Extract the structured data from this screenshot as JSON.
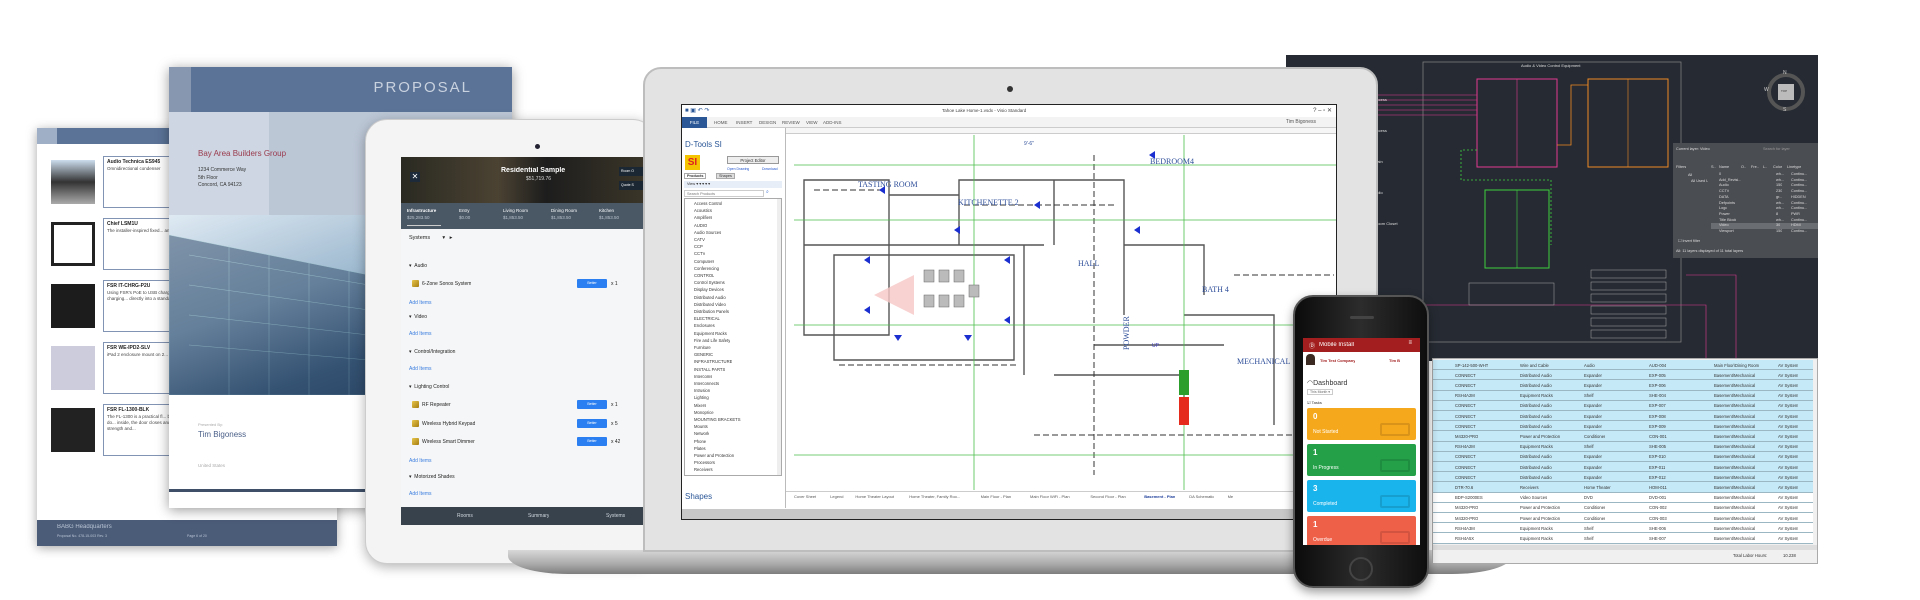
{
  "product_sheet": {
    "items": [
      {
        "title": "Audio Technica ES945",
        "desc": "Omnidirectional condenser"
      },
      {
        "title": "Chief LSM1U",
        "desc": "The installer-inspired fixed... and post-installation fine tu..."
      },
      {
        "title": "FSR IT-CHRG-P2U",
        "desc": "Using FSR's PoE to USB charger... Ethernet drop without the... mounted in a 2-gang wall box... emulate the Apple charging... directly into a standard gang..."
      },
      {
        "title": "FSR WE-IPD2-SLV",
        "desc": "iPad 2 enclosure mount on 2..."
      },
      {
        "title": "FSR FL-1300-BLK",
        "desc": "The FL-1300 is a practical fl... blank plate supplied with th... telecommunication connecti... The cover utilizes a dual do... inside, the door closes and... access door is closed when... The FL-1300 cover, painted... providing both strength and..."
      }
    ],
    "footer_title": "BABG Headquarters",
    "footer_sub": "Proposal No. 478-15-003   Rev. 3",
    "page": "Page 6 of 20"
  },
  "proposal": {
    "title": "PROPOSAL",
    "company": "Bay Area Builders Group",
    "address": [
      "1234 Commerce Way",
      "5th Floor",
      "Concord, CA 94123"
    ],
    "presented_by_label": "Presented By:",
    "presenter": "Tim Bigoness",
    "country": "United States",
    "page": "Page 1 of 20"
  },
  "tablet": {
    "title": "Residential Sample",
    "total": "$51,719.76",
    "hero_buttons": [
      "Room O",
      "Quote S"
    ],
    "tabs": [
      {
        "name": "Infrastructure",
        "amount": "$25,283.50"
      },
      {
        "name": "Entry",
        "amount": "$0.00"
      },
      {
        "name": "Living Room",
        "amount": "$1,853.50"
      },
      {
        "name": "Dining Room",
        "amount": "$1,853.50"
      },
      {
        "name": "Kitchen",
        "amount": "$1,853.50"
      }
    ],
    "systems_label": "Systems",
    "add_items": "Add Items",
    "edit_label": "Better",
    "sections": {
      "audio": "Audio",
      "video": "Video",
      "control": "Control/Integration",
      "lighting": "Lighting Control",
      "shades": "Motorized Shades"
    },
    "items": [
      {
        "name": "6-Zone Sonos System",
        "qty": "x 1"
      },
      {
        "name": "RF Repeater",
        "qty": "x 1"
      },
      {
        "name": "Wireless Hybrid Keypad",
        "qty": "x 5"
      },
      {
        "name": "Wireless Smart Dimmer",
        "qty": "x 42"
      }
    ],
    "nav": [
      "Rooms",
      "Summary",
      "Systems"
    ]
  },
  "laptop": {
    "window_title": "Tahoe Lake Home-1.vsdx - Visio Standard",
    "user": "Tim Bigoness",
    "ribbon_tabs": [
      "FILE",
      "HOME",
      "INSERT",
      "DESIGN",
      "REVIEW",
      "VIEW",
      "ADD-INS"
    ],
    "panel_title": "D-Tools SI",
    "logo": "SI",
    "project_editor": "Project Editor",
    "open_drawing": "Open Drawing",
    "download": "Download",
    "panel_tabs": [
      "Products",
      "Shapes"
    ],
    "view_label": "View",
    "search_placeholder": "Search Products",
    "categories": [
      "Access Control",
      "Acoustics",
      "Amplifiers",
      "AUDIO",
      "Audio Sources",
      "CATV",
      "CCP",
      "CCTV",
      "Computers",
      "Conferencing",
      "CONTROL",
      "Control Systems",
      "Display Devices",
      "Distributed Audio",
      "Distributed Video",
      "Distribution Panels",
      "ELECTRICAL",
      "Enclosures",
      "Equipment Racks",
      "Fire and Life Safety",
      "Furniture",
      "GENERIC",
      "INFRASTRUCTURE",
      "INSTALL PARTS",
      "Intercoms",
      "Interconnects",
      "Intrusion",
      "Lighting",
      "Mixers",
      "Monoprice",
      "MOUNTING BRACKETS",
      "Mounts",
      "Network",
      "Phone",
      "Plates",
      "Power and Protection",
      "Processors",
      "Receivers"
    ],
    "shapes_label": "Shapes",
    "page_tabs": [
      "Cover Sheet",
      "Legend",
      "Home Theater Layout",
      "Home Theater, Family Roo...",
      "Main Floor - Plan",
      "Main Floor WiFi - Plan",
      "Second Floor - Plan",
      "Basement - Plan",
      "DA Schematic",
      "Me"
    ],
    "active_page_tab": "Basement - Plan",
    "rooms": [
      "TASTING ROOM",
      "KITCHENETTE 2",
      "BEDROOM4",
      "HALL",
      "BATH 4",
      "POWDER",
      "MECHANICAL"
    ],
    "dimension": "9'-6\"",
    "stair_label": "UP"
  },
  "cad": {
    "title": "Audio & Video Control Equipment",
    "compass": {
      "n": "N",
      "w": "W",
      "s": "S",
      "top": "TOP"
    },
    "left_labels": [
      "Access",
      "Access",
      "...ain",
      "...dio",
      "...oom Closet"
    ],
    "layer_panel": {
      "current": "Current layer: Video",
      "search": "Search for layer",
      "filters": "Filters",
      "all": "All",
      "all_used": "All Used L",
      "columns": [
        "S..",
        "Name",
        "O..",
        "Fre..",
        "L..",
        "Color",
        "Linetype"
      ],
      "layers": [
        {
          "name": "0",
          "color": "wh...",
          "linetype": "Continu..."
        },
        {
          "name": "Add_Revisi...",
          "color": "wh...",
          "linetype": "Continu..."
        },
        {
          "name": "Audio",
          "color": "150",
          "linetype": "Continu..."
        },
        {
          "name": "CCTV",
          "color": "230",
          "linetype": "Continu..."
        },
        {
          "name": "DATA",
          "color": "gr...",
          "linetype": "HIDDEN"
        },
        {
          "name": "Defpoints",
          "color": "wh...",
          "linetype": "Continu..."
        },
        {
          "name": "Logo",
          "color": "wh...",
          "linetype": "Continu..."
        },
        {
          "name": "Power",
          "color": "8",
          "linetype": "PWR"
        },
        {
          "name": "Title Block",
          "color": "wh...",
          "linetype": "Continu..."
        },
        {
          "name": "Video",
          "color": "30",
          "linetype": "HDMI"
        },
        {
          "name": "Viewport",
          "color": "150",
          "linetype": "Continu..."
        }
      ],
      "invert_filter": "Invert filter",
      "status": "All: 11 layers displayed of 11 total layers"
    },
    "colors": {
      "audio": "#e0398f",
      "video": "#f08a24",
      "data": "#3fd23f"
    }
  },
  "equipment_table": {
    "rows": [
      [
        "SP-142-500-WHT",
        "Wire and Cable",
        "Audio",
        "AUD-004",
        "Main Floor\\Dining Room",
        "AV System"
      ],
      [
        "CONNECT",
        "Distributed Audio",
        "Expander",
        "EXP-005",
        "Basement\\Mechanical",
        "AV System"
      ],
      [
        "CONNECT",
        "Distributed Audio",
        "Expander",
        "EXP-006",
        "Basement\\Mechanical",
        "AV System"
      ],
      [
        "RSH4A2M",
        "Equipment Racks",
        "Shelf",
        "SHE-004",
        "Basement\\Mechanical",
        "AV System"
      ],
      [
        "CONNECT",
        "Distributed Audio",
        "Expander",
        "EXP-007",
        "Basement\\Mechanical",
        "AV System"
      ],
      [
        "CONNECT",
        "Distributed Audio",
        "Expander",
        "EXP-008",
        "Basement\\Mechanical",
        "AV System"
      ],
      [
        "CONNECT",
        "Distributed Audio",
        "Expander",
        "EXP-009",
        "Basement\\Mechanical",
        "AV System"
      ],
      [
        "M4320-PRO",
        "Power and Protection",
        "Conditioner",
        "CON-001",
        "Basement\\Mechanical",
        "AV System"
      ],
      [
        "RSH4A2M",
        "Equipment Racks",
        "Shelf",
        "SHE-005",
        "Basement\\Mechanical",
        "AV System"
      ],
      [
        "CONNECT",
        "Distributed Audio",
        "Expander",
        "EXP-010",
        "Basement\\Mechanical",
        "AV System"
      ],
      [
        "CONNECT",
        "Distributed Audio",
        "Expander",
        "EXP-011",
        "Basement\\Mechanical",
        "AV System"
      ],
      [
        "CONNECT",
        "Distributed Audio",
        "Expander",
        "EXP-012",
        "Basement\\Mechanical",
        "AV System"
      ],
      [
        "DTR-70.6",
        "Receivers",
        "Home Theater",
        "HOM-011",
        "Basement\\Mechanical",
        "AV System"
      ],
      [
        "BDP-S2000ES",
        "Video Sources",
        "DVD",
        "DVD-001",
        "Basement\\Mechanical",
        "AV System"
      ],
      [
        "M4320-PRO",
        "Power and Protection",
        "Conditioner",
        "CON-002",
        "Basement\\Mechanical",
        "AV System"
      ],
      [
        "M4320-PRO",
        "Power and Protection",
        "Conditioner",
        "CON-003",
        "Basement\\Mechanical",
        "AV System"
      ],
      [
        "RSH4A3M",
        "Equipment Racks",
        "Shelf",
        "SHE-006",
        "Basement\\Mechanical",
        "AV System"
      ],
      [
        "RSH4A5X",
        "Equipment Racks",
        "Shelf",
        "SHE-007",
        "Basement\\Mechanical",
        "AV System"
      ]
    ],
    "selected_rows": 13,
    "labor_label": "Total Labor Hours:",
    "labor_value": "10.238"
  },
  "phone": {
    "app_title": "Mobile Install",
    "company": "Tim Test Company",
    "user": "Tim B",
    "dashboard": "Dashboard",
    "period": "This Month",
    "tasks_label": "Tasks",
    "cards": [
      {
        "count": "0",
        "label": "Not Started",
        "color": "#f6a81c"
      },
      {
        "count": "1",
        "label": "In Progress",
        "color": "#24a148"
      },
      {
        "count": "3",
        "label": "Completed",
        "color": "#1ab4ec"
      },
      {
        "count": "1",
        "label": "Overdue",
        "color": "#ef6049"
      }
    ],
    "header_color": "#a31f1f"
  }
}
